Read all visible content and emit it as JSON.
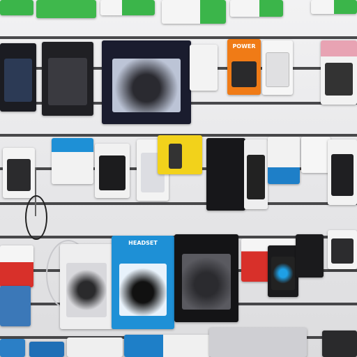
{
  "scene": {
    "kind": "retail-wall-display",
    "description_colors": {
      "wall": "#e9e9ea",
      "rail": "#2c2c2e",
      "green_box": "#3bb54a",
      "blue_box": "#1e90d6",
      "black_pkg": "#1a1a1c",
      "yellow_box": "#f2d21b",
      "orange_box": "#f07b16",
      "red_box": "#d8302a",
      "pink_box": "#e8a3b3"
    }
  },
  "labels": {
    "power_bank_box": "POWER",
    "headset_box": "HEADSET"
  }
}
